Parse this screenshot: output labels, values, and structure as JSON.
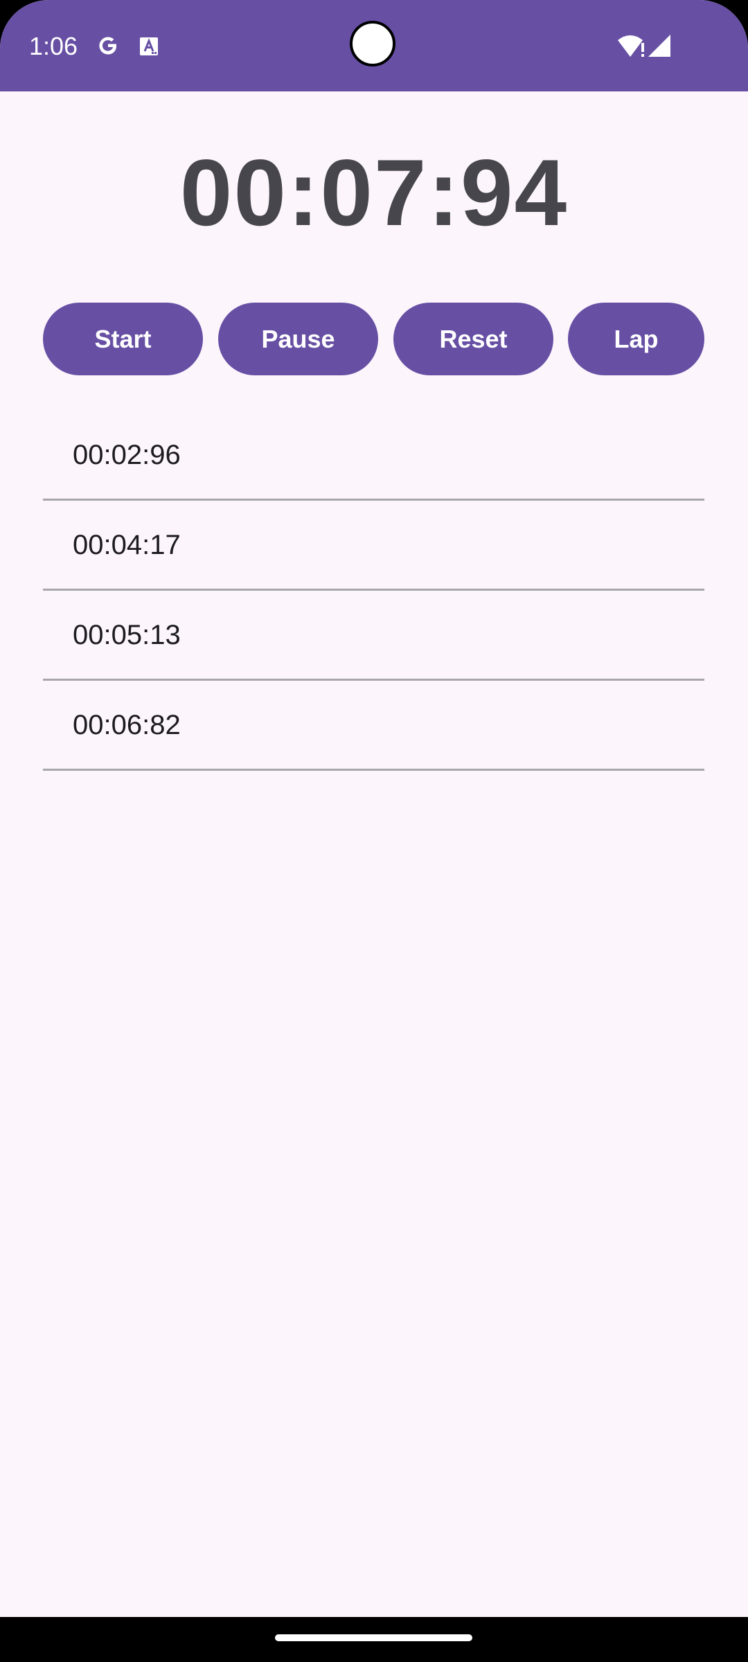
{
  "status_bar": {
    "time": "1:06",
    "background": "#6750A4",
    "icons": [
      "google-icon",
      "text-icon",
      "wifi-icon",
      "signal-icon"
    ]
  },
  "stopwatch": {
    "elapsed": "00:07:94",
    "text_color": "#48464D"
  },
  "controls": {
    "start_label": "Start",
    "pause_label": "Pause",
    "reset_label": "Reset",
    "lap_label": "Lap",
    "button_color": "#6750A4"
  },
  "laps": [
    {
      "time": "00:02:96"
    },
    {
      "time": "00:04:17"
    },
    {
      "time": "00:05:13"
    },
    {
      "time": "00:06:82"
    }
  ],
  "theme": {
    "background": "#FCF5FC",
    "divider": "#A8A6AB"
  }
}
